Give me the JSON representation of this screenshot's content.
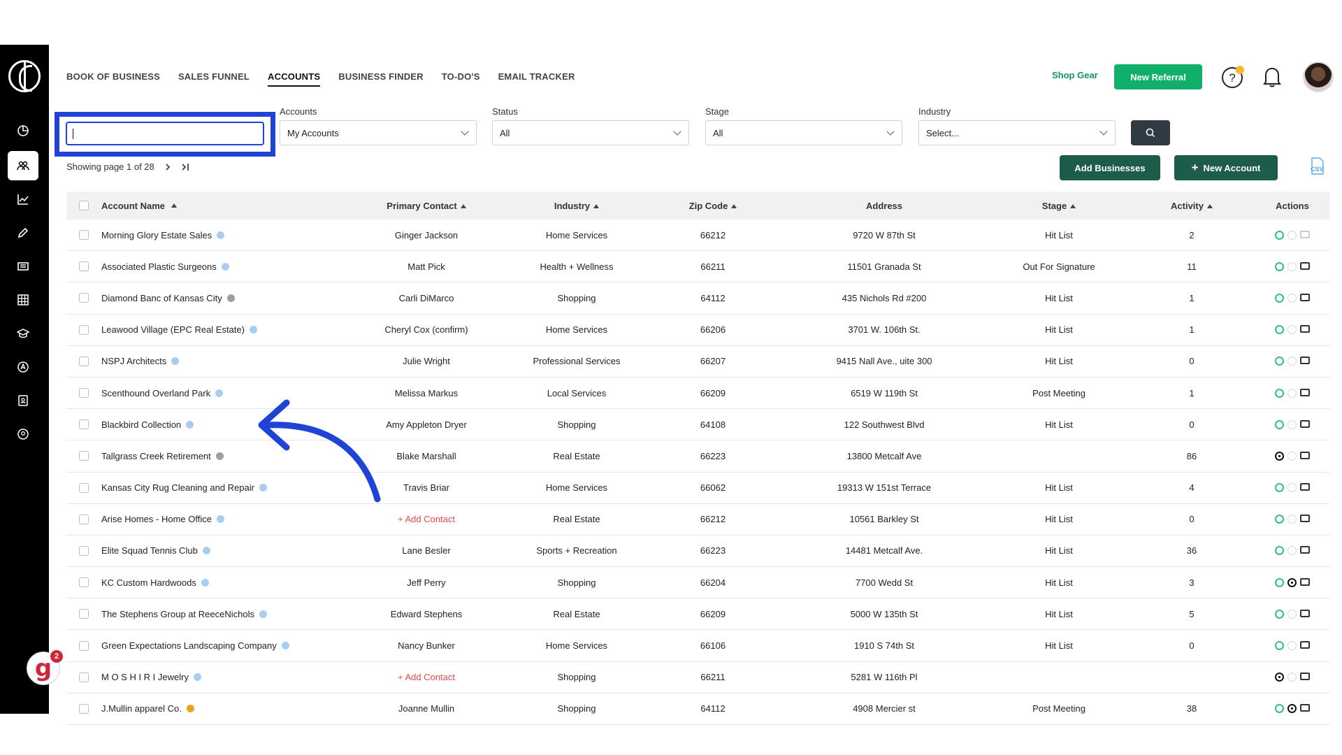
{
  "nav": [
    "BOOK OF BUSINESS",
    "SALES FUNNEL",
    "ACCOUNTS",
    "BUSINESS FINDER",
    "TO-DO'S",
    "EMAIL TRACKER"
  ],
  "header": {
    "shop_gear": "Shop Gear",
    "new_referral": "New Referral"
  },
  "filters": {
    "accounts_label": "Accounts",
    "accounts_value": "My Accounts",
    "status_label": "Status",
    "status_value": "All",
    "stage_label": "Stage",
    "stage_value": "All",
    "industry_label": "Industry",
    "industry_value": "Select..."
  },
  "paging": {
    "text": "Showing page 1 of 28"
  },
  "actions": {
    "add_businesses": "Add Businesses",
    "new_account": "New Account",
    "csv": "CSV"
  },
  "badge_count": "2",
  "columns": {
    "name": "Account Name",
    "contact": "Primary Contact",
    "industry": "Industry",
    "zip": "Zip Code",
    "address": "Address",
    "stage": "Stage",
    "activity": "Activity",
    "actions": "Actions"
  },
  "rows": [
    {
      "name": "Morning Glory Estate Sales",
      "contact": "Ginger Jackson",
      "industry": "Home Services",
      "zip": "66212",
      "address": "9720 W 87th St",
      "stage": "Hit List",
      "activity": "2"
    },
    {
      "name": "Associated Plastic Surgeons",
      "contact": "Matt Pick",
      "industry": "Health + Wellness",
      "zip": "66211",
      "address": "11501 Granada St",
      "stage": "Out For Signature",
      "activity": "11"
    },
    {
      "name": "Diamond Banc of Kansas City",
      "contact": "Carli DiMarco",
      "industry": "Shopping",
      "zip": "64112",
      "address": "435 Nichols Rd #200",
      "stage": "Hit List",
      "activity": "1"
    },
    {
      "name": "Leawood Village (EPC Real Estate)",
      "contact": "Cheryl Cox (confirm)",
      "industry": "Home Services",
      "zip": "66206",
      "address": "3701 W. 106th St.",
      "stage": "Hit List",
      "activity": "1"
    },
    {
      "name": "NSPJ Architects",
      "contact": "Julie Wright",
      "industry": "Professional Services",
      "zip": "66207",
      "address": "9415 Nall Ave., uite 300",
      "stage": "Hit List",
      "activity": "0"
    },
    {
      "name": "Scenthound Overland Park",
      "contact": "Melissa Markus",
      "industry": "Local Services",
      "zip": "66209",
      "address": "6519 W 119th St",
      "stage": "Post Meeting",
      "activity": "1"
    },
    {
      "name": "Blackbird Collection",
      "contact": "Amy Appleton Dryer",
      "industry": "Shopping",
      "zip": "64108",
      "address": "122 Southwest Blvd",
      "stage": "Hit List",
      "activity": "0"
    },
    {
      "name": "Tallgrass Creek Retirement",
      "contact": "Blake Marshall",
      "industry": "Real Estate",
      "zip": "66223",
      "address": "13800 Metcalf Ave",
      "stage": "",
      "activity": "86"
    },
    {
      "name": "Kansas City Rug Cleaning and Repair",
      "contact": "Travis Briar",
      "industry": "Home Services",
      "zip": "66062",
      "address": "19313 W 151st Terrace",
      "stage": "Hit List",
      "activity": "4"
    },
    {
      "name": "Arise Homes - Home Office",
      "contact": "+ Add Contact",
      "industry": "Real Estate",
      "zip": "66212",
      "address": "10561 Barkley St",
      "stage": "Hit List",
      "activity": "0"
    },
    {
      "name": "Elite Squad Tennis Club",
      "contact": "Lane Besler",
      "industry": "Sports + Recreation",
      "zip": "66223",
      "address": "14481 Metcalf Ave.",
      "stage": "Hit List",
      "activity": "36"
    },
    {
      "name": "KC Custom Hardwoods",
      "contact": "Jeff Perry",
      "industry": "Shopping",
      "zip": "66204",
      "address": "7700 Wedd St",
      "stage": "Hit List",
      "activity": "3"
    },
    {
      "name": "The Stephens Group at ReeceNichols",
      "contact": "Edward Stephens",
      "industry": "Real Estate",
      "zip": "66209",
      "address": "5000 W 135th St",
      "stage": "Hit List",
      "activity": "5"
    },
    {
      "name": "Green Expectations Landscaping Company",
      "contact": "Nancy Bunker",
      "industry": "Home Services",
      "zip": "66106",
      "address": "1910 S 74th St",
      "stage": "Hit List",
      "activity": "0"
    },
    {
      "name": "M O S H I R I Jewelry",
      "contact": "+ Add Contact",
      "industry": "Shopping",
      "zip": "66211",
      "address": "5281 W 116th Pl",
      "stage": "",
      "activity": ""
    },
    {
      "name": "J.Mullin apparel Co.",
      "contact": "Joanne Mullin",
      "industry": "Shopping",
      "zip": "64112",
      "address": "4908 Mercier st",
      "stage": "Post Meeting",
      "activity": "38"
    }
  ]
}
